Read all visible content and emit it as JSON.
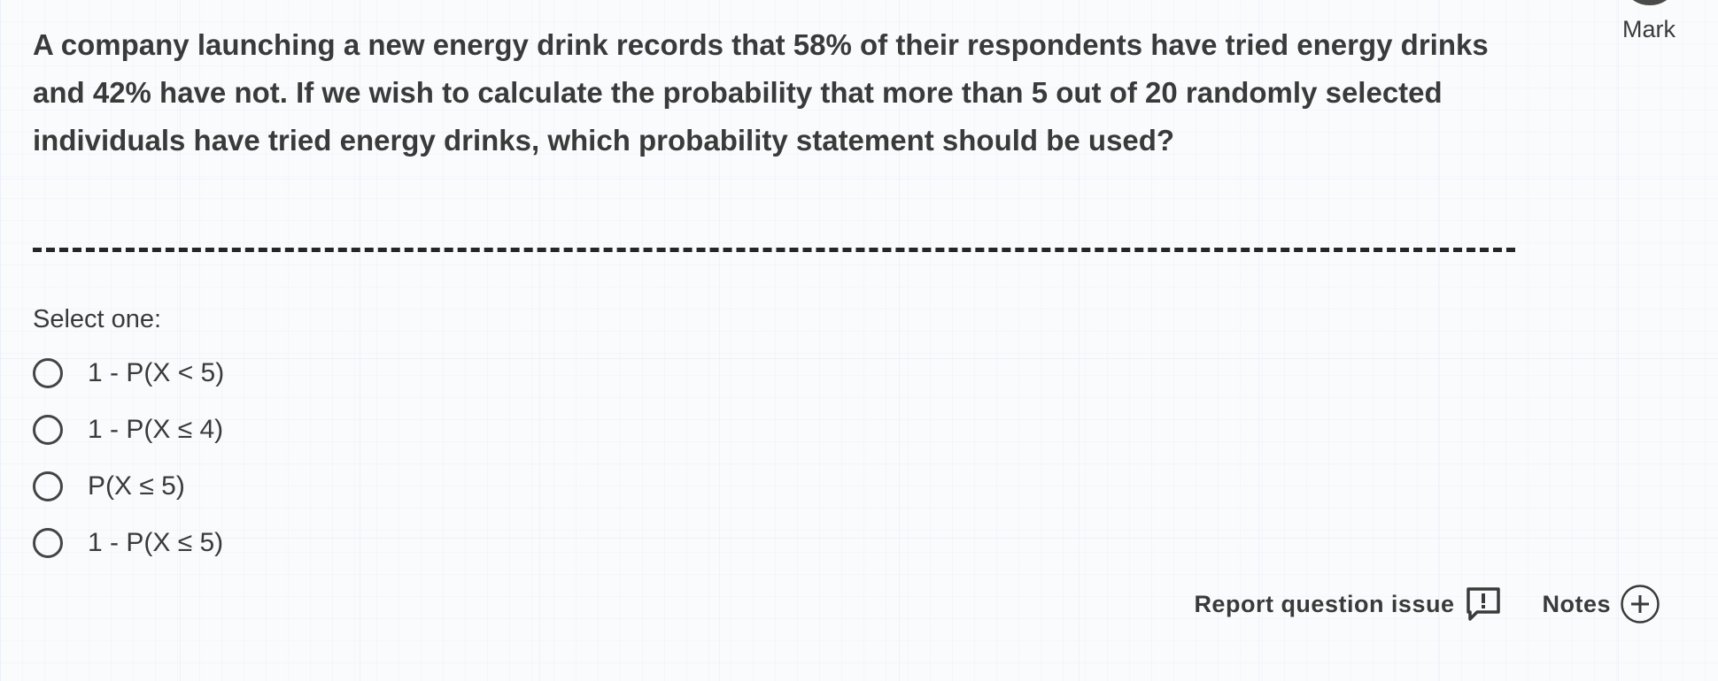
{
  "header": {
    "mark_label": "Mark"
  },
  "question": {
    "text": "A company launching a new energy drink records that 58% of their respondents have tried energy drinks and 42% have not. If we wish to calculate the probability that more than 5 out of 20 randomly selected individuals have tried energy drinks, which probability statement should be used?"
  },
  "answers": {
    "prompt": "Select one:",
    "options": [
      {
        "label": "1 - P(X < 5)",
        "selected": false
      },
      {
        "label": "1 - P(X ≤ 4)",
        "selected": false
      },
      {
        "label": "P(X ≤ 5)",
        "selected": false
      },
      {
        "label": "1 - P(X ≤ 5)",
        "selected": false
      }
    ]
  },
  "footer": {
    "report_label": "Report question issue",
    "notes_label": "Notes"
  },
  "icons": {
    "report": "report-flag-icon",
    "notes": "plus-circle-icon",
    "radio": "radio-unchecked-icon"
  },
  "colors": {
    "text": "#3a3a3a",
    "radio_border": "#444444",
    "divider": "#262626",
    "background": "#f9fbfd"
  }
}
